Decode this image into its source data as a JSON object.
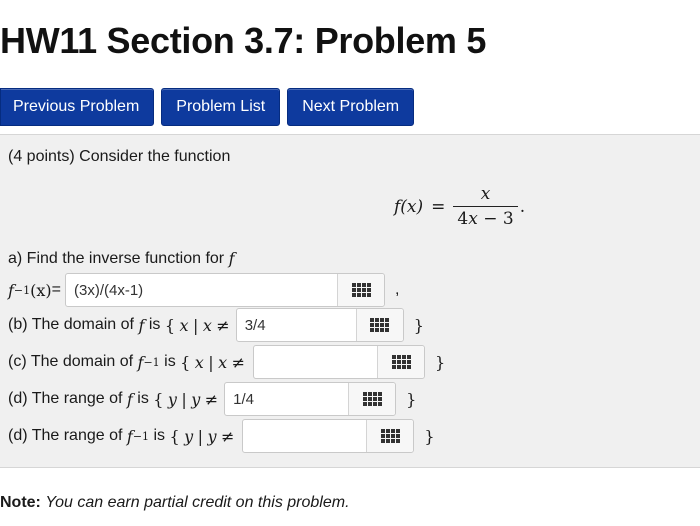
{
  "page": {
    "title": "HW11 Section 3.7: Problem 5"
  },
  "nav": {
    "previous": "Previous Problem",
    "list": "Problem List",
    "next": "Next Problem"
  },
  "problem": {
    "intro": "(4 points) Consider the function",
    "formula": {
      "lhs": "f(x)",
      "eq": "=",
      "numerator": "x",
      "denominator_coef": "4",
      "denominator_var": "x",
      "denominator_rest": " − 3",
      "end": "."
    },
    "part_a": {
      "label": "a) Find the inverse function for",
      "var": "f",
      "answer_prefix": "f",
      "answer_sup": "−1",
      "answer_arg": "(x)",
      "answer_eq": "=",
      "value": "(3x)/(4x-1)",
      "suffix": ","
    },
    "part_b": {
      "label": "(b) The domain of",
      "fn": "f",
      "is": "is",
      "set_open": "{",
      "var": "x",
      "bar": "|",
      "var2": "x",
      "neq": "≠",
      "value": "3/4",
      "set_close": "}"
    },
    "part_c": {
      "label": "(c) The domain of",
      "fn": "f",
      "sup": "−1",
      "is": "is",
      "set_open": "{",
      "var": "x",
      "bar": "|",
      "var2": "x",
      "neq": "≠",
      "value": "",
      "set_close": "}"
    },
    "part_d1": {
      "label": "(d) The range of",
      "fn": "f",
      "is": "is",
      "set_open": "{",
      "var": "y",
      "bar": "|",
      "var2": "y",
      "neq": "≠",
      "value": "1/4",
      "set_close": "}"
    },
    "part_d2": {
      "label": "(d) The range of",
      "fn": "f",
      "sup": "−1",
      "is": "is",
      "set_open": "{",
      "var": "y",
      "bar": "|",
      "var2": "y",
      "neq": "≠",
      "value": "",
      "set_close": "}"
    }
  },
  "note": {
    "label": "Note:",
    "text": "You can earn partial credit on this problem."
  },
  "icons": {
    "equation_editor": "grid-icon"
  }
}
